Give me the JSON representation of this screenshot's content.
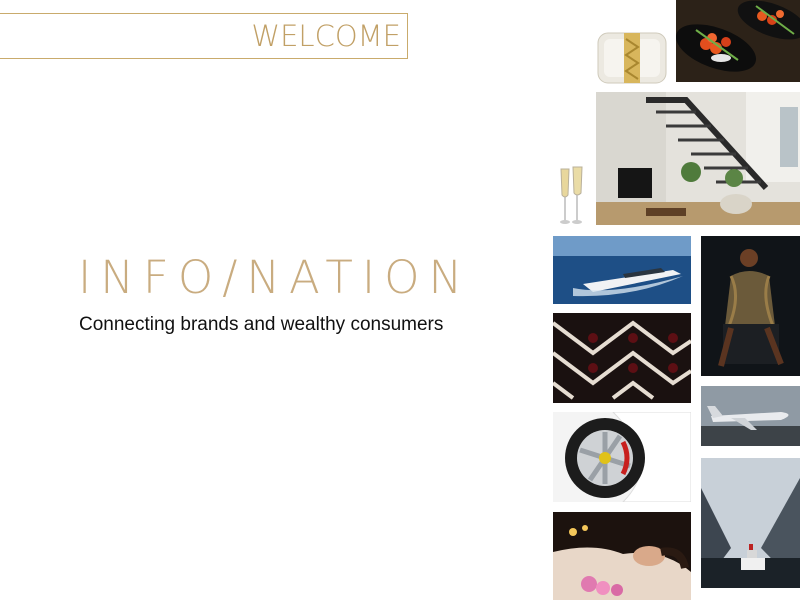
{
  "header": {
    "welcome_label": "WELCOME"
  },
  "hero": {
    "brand_name": "INFO/NATION",
    "tagline": "Connecting brands and wealthy consumers"
  },
  "gallery": {
    "images": [
      {
        "icon": "clutch-bag"
      },
      {
        "icon": "caviar-appetizer"
      },
      {
        "icon": "luxury-interior"
      },
      {
        "icon": "champagne-glasses"
      },
      {
        "icon": "speed-yacht"
      },
      {
        "icon": "fashion-model"
      },
      {
        "icon": "wine-rack"
      },
      {
        "icon": "private-jet"
      },
      {
        "icon": "sports-car-wheel"
      },
      {
        "icon": "fjord-cruise-ship"
      },
      {
        "icon": "spa-relaxation"
      }
    ]
  },
  "colors": {
    "gold": "#c1a066",
    "text": "#111111",
    "background": "#ffffff"
  }
}
